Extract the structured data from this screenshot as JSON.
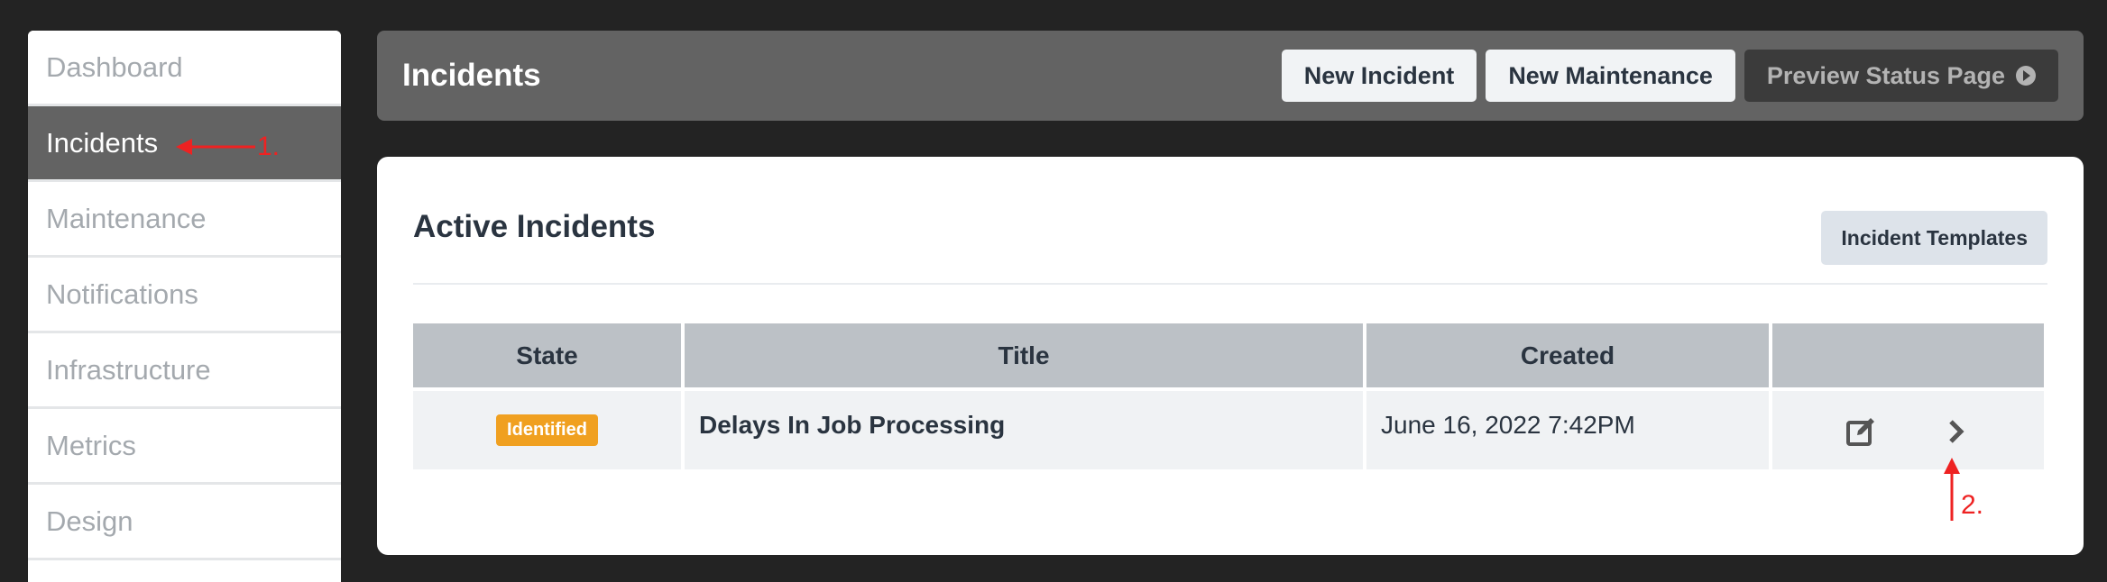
{
  "sidebar": {
    "items": [
      {
        "label": "Dashboard"
      },
      {
        "label": "Incidents"
      },
      {
        "label": "Maintenance"
      },
      {
        "label": "Notifications"
      },
      {
        "label": "Infrastructure"
      },
      {
        "label": "Metrics"
      },
      {
        "label": "Design"
      }
    ],
    "active": "Incidents"
  },
  "header": {
    "title": "Incidents",
    "buttons": {
      "new_incident": "New Incident",
      "new_maintenance": "New Maintenance",
      "preview_status_page": "Preview Status Page"
    }
  },
  "card": {
    "title": "Active Incidents",
    "templates_button": "Incident Templates",
    "table": {
      "headers": [
        "State",
        "Title",
        "Created",
        ""
      ],
      "rows": [
        {
          "state": "Identified",
          "title": "Delays In Job Processing",
          "created": "June 16, 2022 7:42PM"
        }
      ]
    }
  },
  "annotations": {
    "one": "1.",
    "two": "2."
  },
  "colors": {
    "badge_identified": "#f0a020",
    "annotation": "#ee2222",
    "header_bg": "#636363",
    "page_bg": "#232323"
  }
}
